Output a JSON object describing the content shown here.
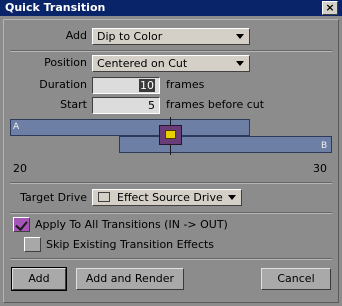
{
  "window": {
    "title": "Quick Transition",
    "close_glyph": "×"
  },
  "form": {
    "add": {
      "label": "Add",
      "value": "Dip to Color"
    },
    "position": {
      "label": "Position",
      "value": "Centered on Cut"
    },
    "duration": {
      "label": "Duration",
      "value": "10",
      "unit": "frames"
    },
    "start": {
      "label": "Start",
      "value": "5",
      "unit": "frames before cut"
    }
  },
  "timeline": {
    "track_a_label": "A",
    "track_b_label": "B",
    "start_tick": "20",
    "end_tick": "30"
  },
  "target_drive": {
    "label": "Target Drive",
    "value": "Effect Source Drive"
  },
  "options": {
    "apply_all": {
      "label": "Apply To All Transitions (IN -> OUT)",
      "checked": true
    },
    "skip_existing": {
      "label": "Skip Existing Transition Effects",
      "checked": false
    }
  },
  "buttons": {
    "add": "Add",
    "add_render": "Add and Render",
    "cancel": "Cancel"
  },
  "colors": {
    "title_bar": "#0a246a",
    "track": "#6d7fa4",
    "handle": "#6a3d78",
    "checkbox_checked": "#a455b6"
  }
}
